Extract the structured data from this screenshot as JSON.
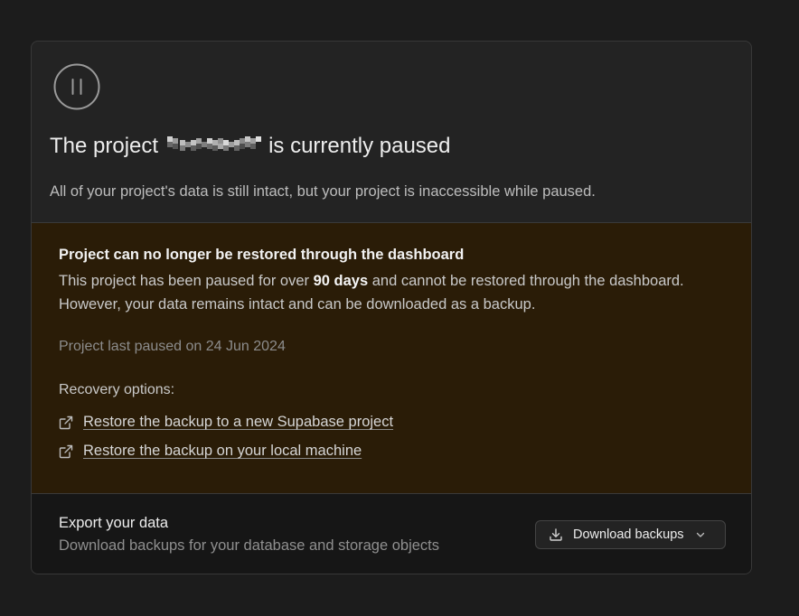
{
  "header": {
    "icon": "pause-circle-icon",
    "title_prefix": "The project",
    "title_suffix": "is currently paused",
    "subtitle": "All of your project's data is still intact, but your project is inaccessible while paused."
  },
  "warning": {
    "title": "Project can no longer be restored through the dashboard",
    "body_before": "This project has been paused for over ",
    "body_bold": "90 days",
    "body_after": " and cannot be restored through the dashboard. However, your data remains intact and can be downloaded as a backup.",
    "last_paused": "Project last paused on 24 Jun 2024",
    "recovery_label": "Recovery options:",
    "links": [
      {
        "label": "Restore the backup to a new Supabase project",
        "icon": "external-link-icon"
      },
      {
        "label": "Restore the backup on your local machine",
        "icon": "external-link-icon"
      }
    ],
    "background": "#2a1c07"
  },
  "export": {
    "title": "Export your data",
    "description": "Download backups for your database and storage objects",
    "button_label": "Download backups",
    "button_icon": "download-icon",
    "dropdown_icon": "chevron-down-icon"
  }
}
